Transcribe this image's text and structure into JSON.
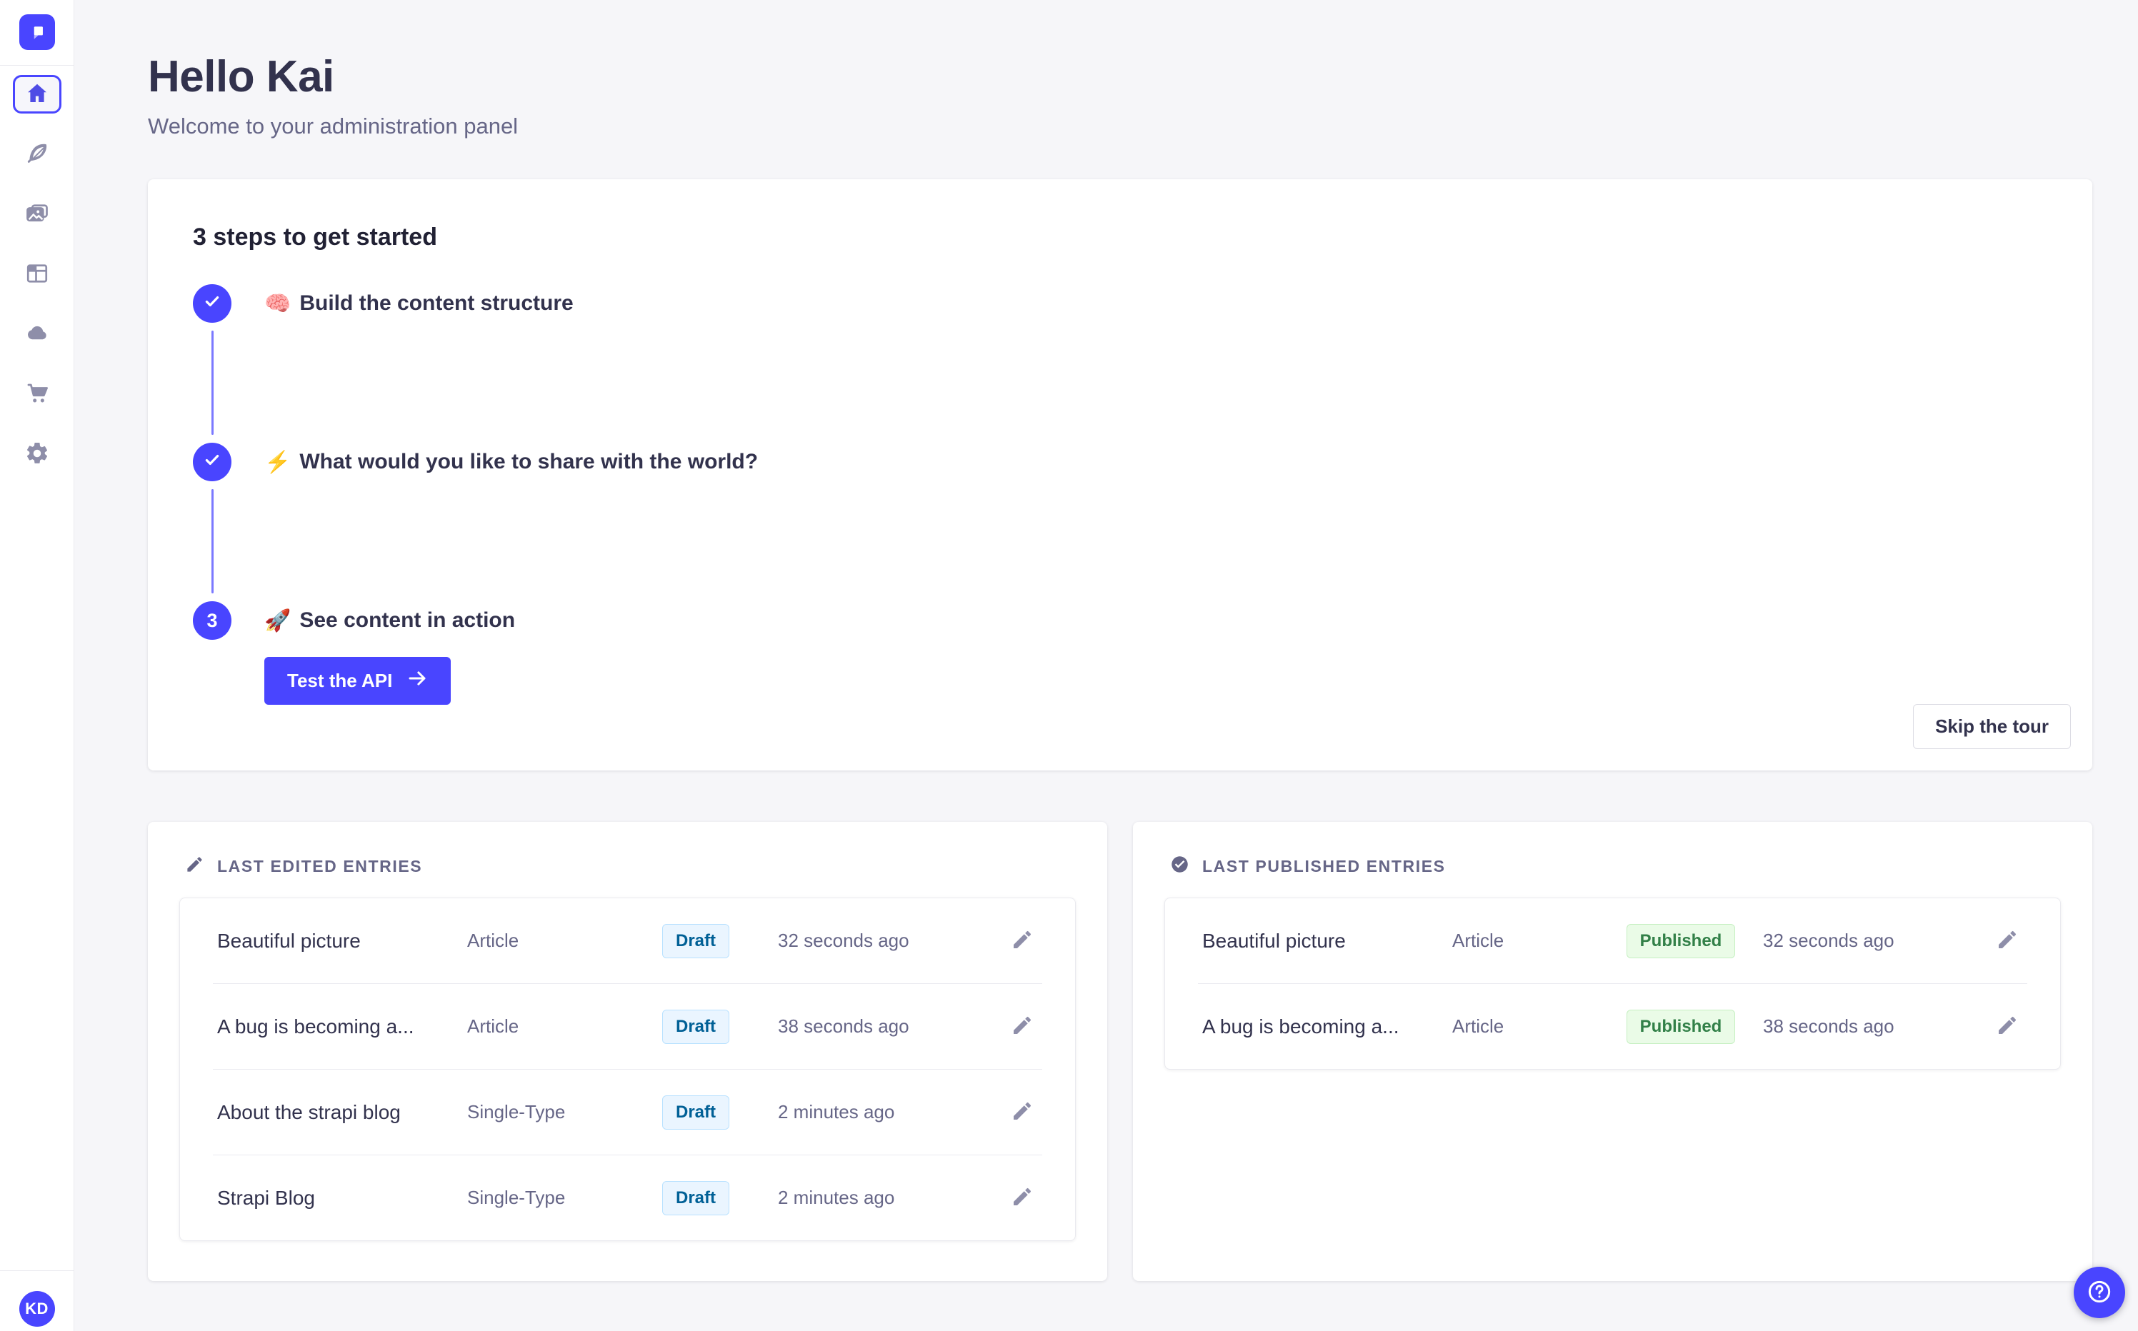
{
  "colors": {
    "primary": "#4945FF",
    "connector": "#7B79FF",
    "background": "#F6F6F9",
    "text_dark": "#32324D",
    "text_muted": "#666687",
    "icon_gray": "#8E8EA9",
    "draft_bg": "#EAF5FF",
    "draft_border": "#B8E1FF",
    "draft_text": "#006096",
    "published_bg": "#EAFBE7",
    "published_border": "#C6F0C2",
    "published_text": "#328048"
  },
  "sidebar": {
    "logo_icon": "strapi-logo",
    "items": [
      {
        "icon": "home-icon",
        "active": true
      },
      {
        "icon": "content-manager-feather-icon",
        "active": false
      },
      {
        "icon": "media-library-pictures-icon",
        "active": false
      },
      {
        "icon": "content-type-builder-layout-icon",
        "active": false
      },
      {
        "icon": "cloud-icon",
        "active": false
      },
      {
        "icon": "marketplace-cart-icon",
        "active": false
      },
      {
        "icon": "settings-gear-icon",
        "active": false
      }
    ],
    "avatar_initials": "KD"
  },
  "header": {
    "title": "Hello Kai",
    "subtitle": "Welcome to your administration panel"
  },
  "tour": {
    "title": "3 steps to get started",
    "steps": [
      {
        "marker": "check",
        "emoji": "🧠",
        "label": "Build the content structure",
        "done": true
      },
      {
        "marker": "check",
        "emoji": "⚡",
        "label": "What would you like to share with the world?",
        "done": true
      },
      {
        "marker": "3",
        "emoji": "🚀",
        "label": "See content in action",
        "done": false
      }
    ],
    "action_label": "Test the API",
    "skip_label": "Skip the tour"
  },
  "panels": {
    "edited": {
      "icon": "pencil-icon",
      "title": "LAST EDITED ENTRIES",
      "rows": [
        {
          "title": "Beautiful picture",
          "type": "Article",
          "status": "Draft",
          "time": "32 seconds ago"
        },
        {
          "title": "A bug is becoming a...",
          "type": "Article",
          "status": "Draft",
          "time": "38 seconds ago"
        },
        {
          "title": "About the strapi blog",
          "type": "Single-Type",
          "status": "Draft",
          "time": "2 minutes ago"
        },
        {
          "title": "Strapi Blog",
          "type": "Single-Type",
          "status": "Draft",
          "time": "2 minutes ago"
        }
      ]
    },
    "published": {
      "icon": "check-circle-icon",
      "title": "LAST PUBLISHED ENTRIES",
      "rows": [
        {
          "title": "Beautiful picture",
          "type": "Article",
          "status": "Published",
          "time": "32 seconds ago"
        },
        {
          "title": "A bug is becoming a...",
          "type": "Article",
          "status": "Published",
          "time": "38 seconds ago"
        }
      ]
    }
  },
  "help_button": {
    "icon": "question-mark-icon"
  }
}
